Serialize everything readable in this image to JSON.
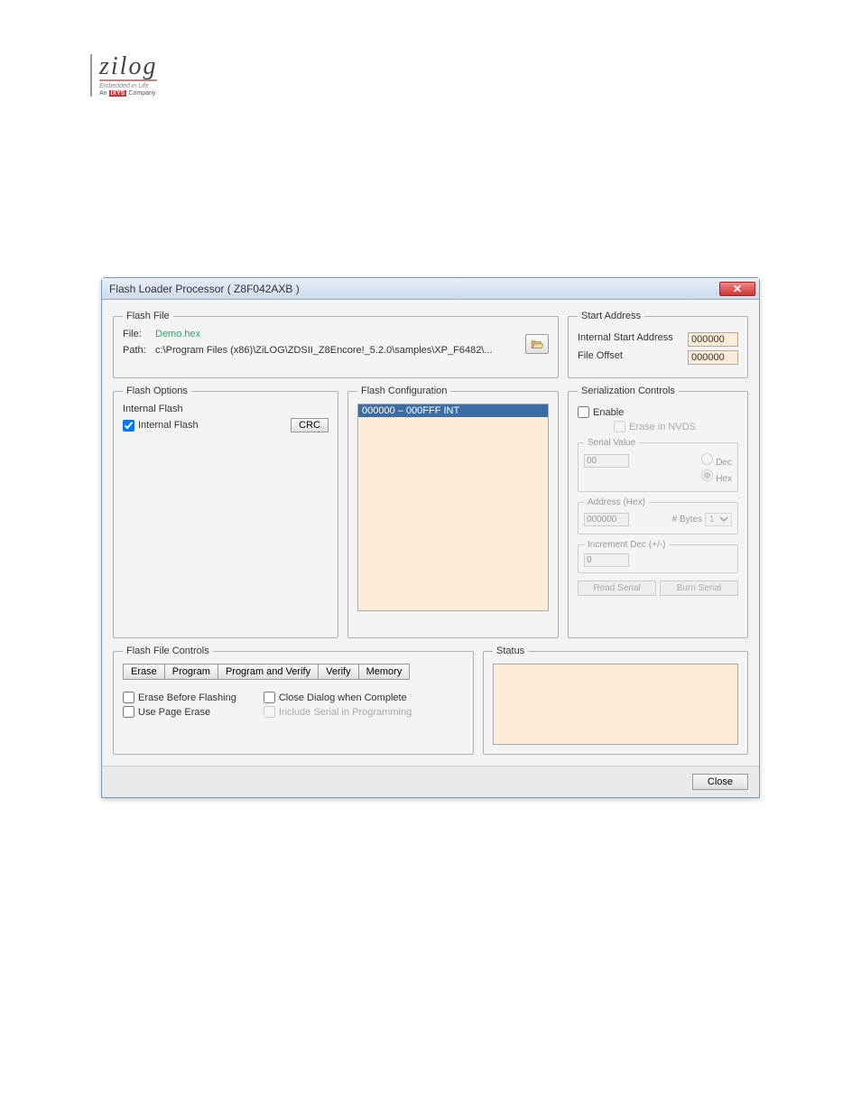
{
  "logo": {
    "brand": "zilog",
    "tag1": "Embedded in Life",
    "tag2_prefix": "An ",
    "tag2_mark": "IXYS",
    "tag2_suffix": " Company"
  },
  "window": {
    "title": "Flash Loader Processor ( Z8F042AXB )",
    "close_glyph": "✕"
  },
  "flash_file": {
    "legend": "Flash File",
    "file_label": "File:",
    "file_value": "Demo.hex",
    "path_label": "Path:",
    "path_value": "c:\\Program Files (x86)\\ZiLOG\\ZDSII_Z8Encore!_5.2.0\\samples\\XP_F6482\\..."
  },
  "start_address": {
    "legend": "Start Address",
    "internal_label": "Internal Start Address",
    "internal_value": "000000",
    "offset_label": "File Offset",
    "offset_value": "000000"
  },
  "flash_options": {
    "legend": "Flash Options",
    "internal_flash_heading": "Internal Flash",
    "internal_flash_checkbox": "Internal Flash",
    "crc_button": "CRC"
  },
  "flash_config": {
    "legend": "Flash Configuration",
    "selected_item": "000000 – 000FFF INT"
  },
  "serialization": {
    "legend": "Serialization Controls",
    "enable_label": "Enable",
    "erase_nvds_label": "Erase in NVDS",
    "serial_value_legend": "Serial Value",
    "serial_value": "00",
    "dec_label": "Dec",
    "hex_label": "Hex",
    "addr_legend": "Address (Hex)",
    "addr_value": "000000",
    "bytes_label": "# Bytes",
    "bytes_value": "1",
    "incr_legend": "Increment Dec (+/-)",
    "incr_value": "0",
    "read_btn": "Read Serial",
    "burn_btn": "Burn Serial"
  },
  "flash_file_controls": {
    "legend": "Flash File Controls",
    "buttons": {
      "erase": "Erase",
      "program": "Program",
      "program_verify": "Program and Verify",
      "verify": "Verify",
      "memory": "Memory"
    },
    "erase_before": "Erase Before Flashing",
    "close_dialog": "Close Dialog when Complete",
    "use_page_erase": "Use Page Erase",
    "include_serial": "Include Serial in Programming"
  },
  "status": {
    "legend": "Status"
  },
  "footer": {
    "close_label": "Close"
  }
}
